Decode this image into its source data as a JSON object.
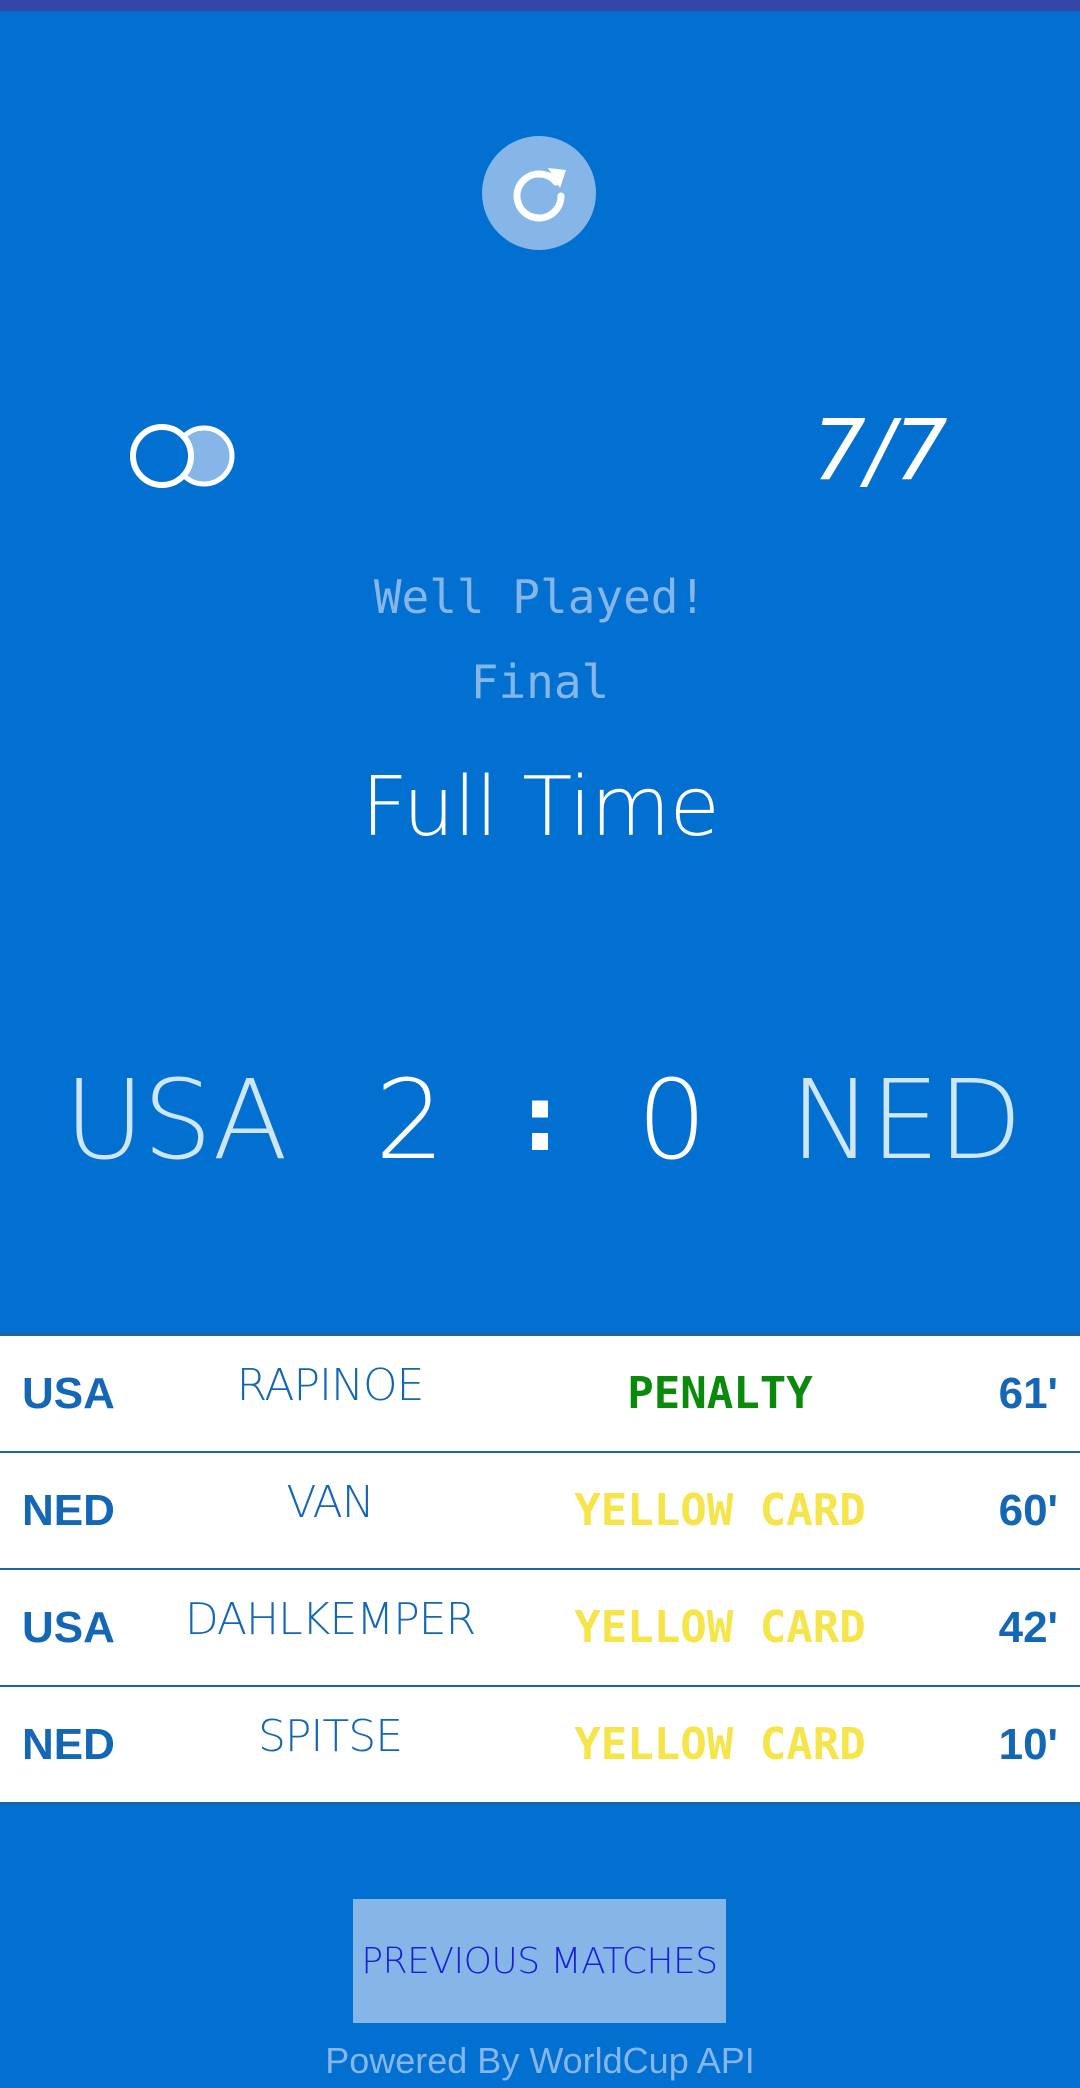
{
  "theme": {
    "background": "#0270d0",
    "accent_light": "#86b6e8",
    "penalty_color": "#0a8a0a",
    "yellow_card_color": "#f5e44a",
    "button_text_color": "#1a1fd6"
  },
  "header": {
    "refresh_icon": "refresh-icon",
    "weather_icon": "cloudy-icon",
    "date": "7/7"
  },
  "match": {
    "message": "Well Played!",
    "stage": "Final",
    "status": "Full Time",
    "home_team": "USA",
    "home_goals": "2",
    "separator": ":",
    "away_goals": "0",
    "away_team": "NED"
  },
  "events": [
    {
      "team": "USA",
      "player": "RAPINOE",
      "type": "PENALTY",
      "minute": "61'",
      "kind": "penalty"
    },
    {
      "team": "NED",
      "player": "VAN",
      "type": "YELLOW CARD",
      "minute": "60'",
      "kind": "yellow"
    },
    {
      "team": "USA",
      "player": "DAHLKEMPER",
      "type": "YELLOW CARD",
      "minute": "42'",
      "kind": "yellow"
    },
    {
      "team": "NED",
      "player": "SPITSE",
      "type": "YELLOW CARD",
      "minute": "10'",
      "kind": "yellow"
    }
  ],
  "actions": {
    "previous_matches": "PREVIOUS MATCHES"
  },
  "footer": {
    "powered_by": "Powered By WorldCup API"
  }
}
